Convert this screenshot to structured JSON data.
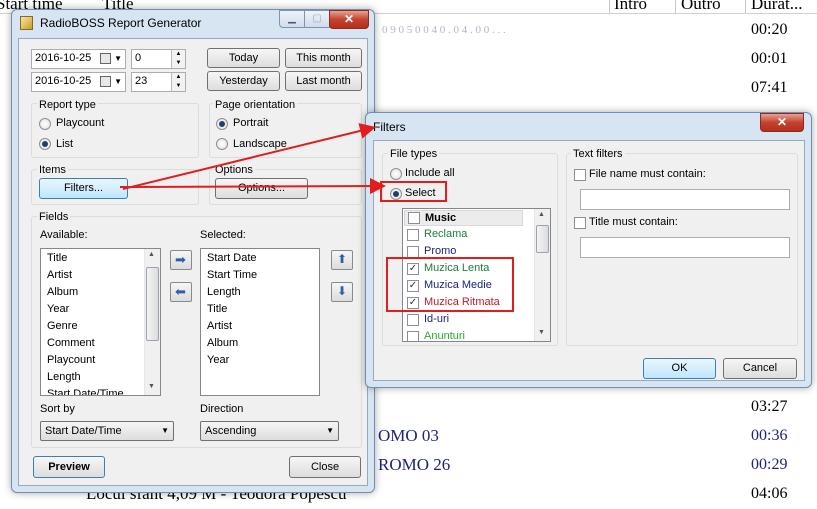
{
  "background": {
    "headers": [
      "Start time",
      "Title",
      "Intro",
      "Outro",
      "Durat..."
    ],
    "durations": [
      "00:20",
      "00:01",
      "07:41",
      "03:27",
      "00:36",
      "00:29",
      "04:06"
    ],
    "titles": [
      "OMO 03",
      "ROMO 26",
      "Locul sfant  4,09  M - Teodora Popescu"
    ]
  },
  "report_window": {
    "title": "RadioBOSS Report Generator",
    "date_from": "2016-10-25",
    "hour_from": "0",
    "date_to": "2016-10-25",
    "hour_to": "23",
    "today": "Today",
    "this_month": "This month",
    "yesterday": "Yesterday",
    "last_month": "Last month",
    "report_type_label": "Report type",
    "playcount": "Playcount",
    "list": "List",
    "report_type_selected": "List",
    "orientation_label": "Page orientation",
    "portrait": "Portrait",
    "landscape": "Landscape",
    "orientation_selected": "Portrait",
    "items_label": "Items",
    "filters_button": "Filters...",
    "options_label": "Options",
    "options_button": "Options...",
    "fields_label": "Fields",
    "available_label": "Available:",
    "selected_label": "Selected:",
    "available": [
      "Title",
      "Artist",
      "Album",
      "Year",
      "Genre",
      "Comment",
      "Playcount",
      "Length",
      "Start Date/Time"
    ],
    "selected": [
      "Start Date",
      "Start Time",
      "Length",
      "Title",
      "Artist",
      "Album",
      "Year"
    ],
    "sort_by_label": "Sort by",
    "sort_by_value": "Start Date/Time",
    "direction_label": "Direction",
    "direction_value": "Ascending",
    "preview_button": "Preview",
    "close_button": "Close"
  },
  "filters_window": {
    "title": "Filters",
    "file_types_label": "File types",
    "include_all": "Include all",
    "select": "Select",
    "file_type_mode": "Select",
    "categories": [
      {
        "name": "Music",
        "checked": false,
        "color": "#000000",
        "bold": true
      },
      {
        "name": "Reclama",
        "checked": false,
        "color": "#1c7c3c"
      },
      {
        "name": "Promo",
        "checked": false,
        "color": "#1a237e"
      },
      {
        "name": "Muzica Lenta",
        "checked": true,
        "color": "#1c7c3c"
      },
      {
        "name": "Muzica Medie",
        "checked": true,
        "color": "#1a237e"
      },
      {
        "name": "Muzica Ritmata",
        "checked": true,
        "color": "#c0182e"
      },
      {
        "name": "Id-uri",
        "checked": false,
        "color": "#1a237e"
      },
      {
        "name": "Anunturi",
        "checked": false,
        "color": "#2ea82e"
      }
    ],
    "text_filters_label": "Text filters",
    "file_name_label": "File name must contain:",
    "file_name_value": "",
    "title_label": "Title must contain:",
    "title_value": "",
    "ok_button": "OK",
    "cancel_button": "Cancel"
  },
  "colors": {
    "highlight": "#e21d1d",
    "window_frame": "#d7e4f2"
  }
}
